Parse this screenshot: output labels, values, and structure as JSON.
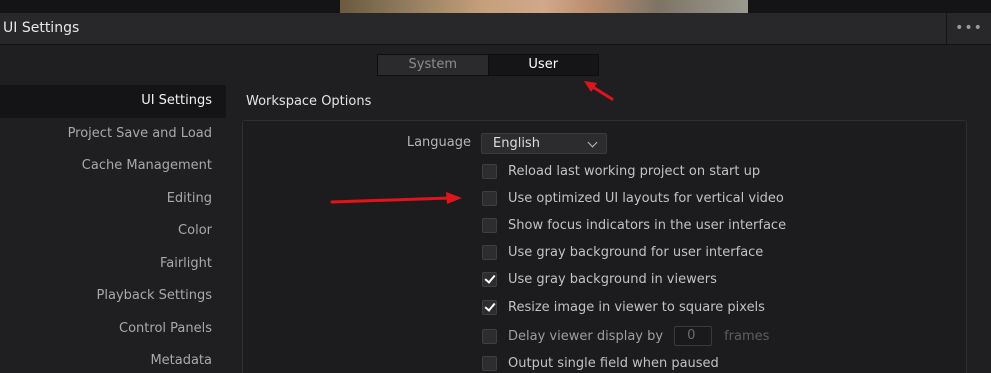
{
  "window": {
    "title": "UI Settings",
    "more_icon": "more-horizontal-icon",
    "more_glyph": "•••"
  },
  "tabs": [
    {
      "label": "System",
      "active": false
    },
    {
      "label": "User",
      "active": true
    }
  ],
  "sidebar": {
    "items": [
      {
        "label": "UI Settings",
        "active": true
      },
      {
        "label": "Project Save and Load",
        "active": false
      },
      {
        "label": "Cache Management",
        "active": false
      },
      {
        "label": "Editing",
        "active": false
      },
      {
        "label": "Color",
        "active": false
      },
      {
        "label": "Fairlight",
        "active": false
      },
      {
        "label": "Playback Settings",
        "active": false
      },
      {
        "label": "Control Panels",
        "active": false
      },
      {
        "label": "Metadata",
        "active": false
      }
    ]
  },
  "workspace": {
    "section_title": "Workspace Options",
    "language_label": "Language",
    "language_value": "English",
    "options": [
      {
        "label": "Reload last working project on start up",
        "checked": false
      },
      {
        "label": "Use optimized UI layouts for vertical video",
        "checked": false
      },
      {
        "label": "Show focus indicators in the user interface",
        "checked": false
      },
      {
        "label": "Use gray background for user interface",
        "checked": false
      },
      {
        "label": "Use gray background in viewers",
        "checked": true
      },
      {
        "label": "Resize image in viewer to square pixels",
        "checked": true
      },
      {
        "label": "Delay viewer display by",
        "checked": false,
        "input_value": "0",
        "unit": "frames"
      },
      {
        "label": "Output single field when paused",
        "checked": false
      }
    ]
  },
  "colors": {
    "annotation_arrow": "#e0141b",
    "background": "#1f1f22",
    "active_sidebar": "#141416"
  }
}
